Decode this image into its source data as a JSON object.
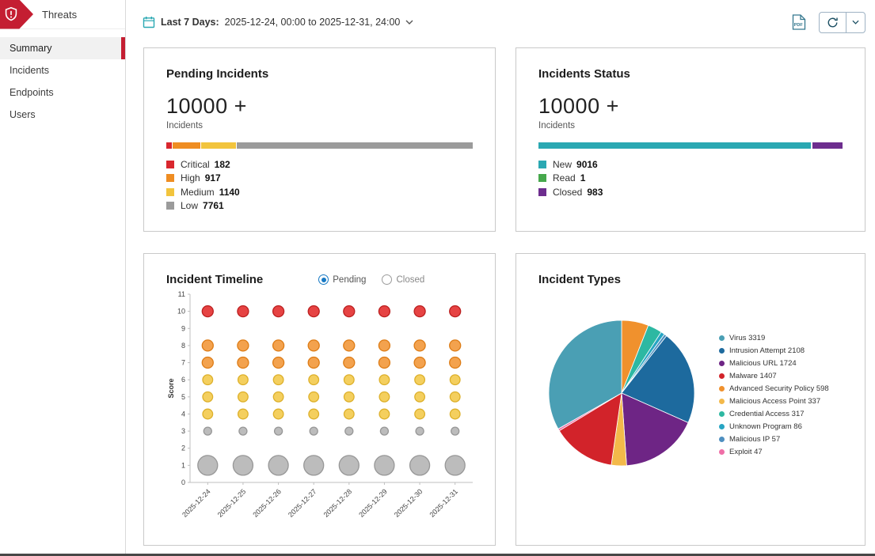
{
  "colors": {
    "brand_red": "#c41e32",
    "radio_selected": "#1779c4",
    "card_border": "#c9c9c9",
    "axis": "#bfbfbf"
  },
  "sidebar": {
    "title": "Threats",
    "items": [
      {
        "label": "Summary",
        "active": true
      },
      {
        "label": "Incidents",
        "active": false
      },
      {
        "label": "Endpoints",
        "active": false
      },
      {
        "label": "Users",
        "active": false
      }
    ]
  },
  "topbar": {
    "date_range_label": "Last 7 Days:",
    "date_range_value": "2025-12-24, 00:00 to 2025-12-31, 24:00",
    "icons": {
      "calendar": "calendar-icon",
      "date_chevron": "chevron-down-icon",
      "pdf_export": "pdf-export-icon",
      "refresh": "refresh-icon",
      "refresh_chevron": "chevron-down-icon"
    }
  },
  "cards": {
    "pending_incidents": {
      "title": "Pending Incidents",
      "count": "10000 +",
      "count_label": "Incidents"
    },
    "incidents_status": {
      "title": "Incidents Status",
      "count": "10000 +",
      "count_label": "Incidents"
    },
    "incident_timeline": {
      "title": "Incident Timeline",
      "radios": [
        {
          "label": "Pending",
          "selected": true
        },
        {
          "label": "Closed",
          "selected": false
        }
      ]
    },
    "incident_types": {
      "title": "Incident Types"
    }
  },
  "chart_data": [
    {
      "id": "pending_incidents_bar",
      "type": "bar",
      "variant": "stacked-horizontal",
      "title": "Pending Incidents",
      "total_label": "10000 +",
      "categories": [
        "Critical",
        "High",
        "Medium",
        "Low"
      ],
      "values": [
        182,
        917,
        1140,
        7761
      ],
      "colors": [
        "#d9272e",
        "#ef8d22",
        "#f2c43d",
        "#9b9b9b"
      ]
    },
    {
      "id": "incidents_status_bar",
      "type": "bar",
      "variant": "stacked-horizontal",
      "title": "Incidents Status",
      "total_label": "10000 +",
      "categories": [
        "New",
        "Read",
        "Closed"
      ],
      "values": [
        9016,
        1,
        983
      ],
      "colors": [
        "#2aa8b2",
        "#46a84c",
        "#6d2d8e"
      ]
    },
    {
      "id": "incident_timeline_bubbles",
      "type": "scatter",
      "title": "Incident Timeline",
      "xlabel": "",
      "ylabel": "Score",
      "ylim": [
        0,
        11
      ],
      "grid": false,
      "x": [
        "2025-12-24",
        "2025-12-25",
        "2025-12-26",
        "2025-12-27",
        "2025-12-28",
        "2025-12-29",
        "2025-12-30",
        "2025-12-31"
      ],
      "bubbles_per_date": true,
      "bubbles": [
        {
          "score": 10,
          "color": "#e64343",
          "stroke": "#bb1f1f",
          "radius": 7
        },
        {
          "score": 8,
          "color": "#f3a24e",
          "stroke": "#dd7c16",
          "radius": 7
        },
        {
          "score": 7,
          "color": "#f3a24e",
          "stroke": "#dd7c16",
          "radius": 7
        },
        {
          "score": 6,
          "color": "#f4cf5e",
          "stroke": "#ddb02b",
          "radius": 6.3
        },
        {
          "score": 5,
          "color": "#f4cf5e",
          "stroke": "#ddb02b",
          "radius": 6.3
        },
        {
          "score": 4,
          "color": "#f4cf5e",
          "stroke": "#ddb02b",
          "radius": 6.3
        },
        {
          "score": 3,
          "color": "#bcbcbc",
          "stroke": "#979797",
          "radius": 5
        },
        {
          "score": 1,
          "color": "#bcbcbc",
          "stroke": "#979797",
          "radius": 12.5
        }
      ]
    },
    {
      "id": "incident_types_pie",
      "type": "pie",
      "title": "Incident Types",
      "legend_position": "right",
      "items": [
        {
          "label": "Virus",
          "value": 3319,
          "color": "#4a9fb4"
        },
        {
          "label": "Intrusion Attempt",
          "value": 2108,
          "color": "#1d6a9e"
        },
        {
          "label": "Malicious URL",
          "value": 1724,
          "color": "#6e2585"
        },
        {
          "label": "Malware",
          "value": 1407,
          "color": "#d2232a"
        },
        {
          "label": "Advanced Security Policy",
          "value": 598,
          "color": "#f0912d"
        },
        {
          "label": "Malicious Access Point",
          "value": 337,
          "color": "#f3b94a"
        },
        {
          "label": "Credential Access",
          "value": 317,
          "color": "#2db8a2"
        },
        {
          "label": "Unknown Program",
          "value": 86,
          "color": "#27a5c3"
        },
        {
          "label": "Malicious IP",
          "value": 57,
          "color": "#4e8fc0"
        },
        {
          "label": "Exploit",
          "value": 47,
          "color": "#ef6fa7"
        }
      ],
      "order_clockwise_from_top": [
        4,
        6,
        7,
        8,
        1,
        2,
        5,
        3,
        9,
        0
      ]
    }
  ]
}
